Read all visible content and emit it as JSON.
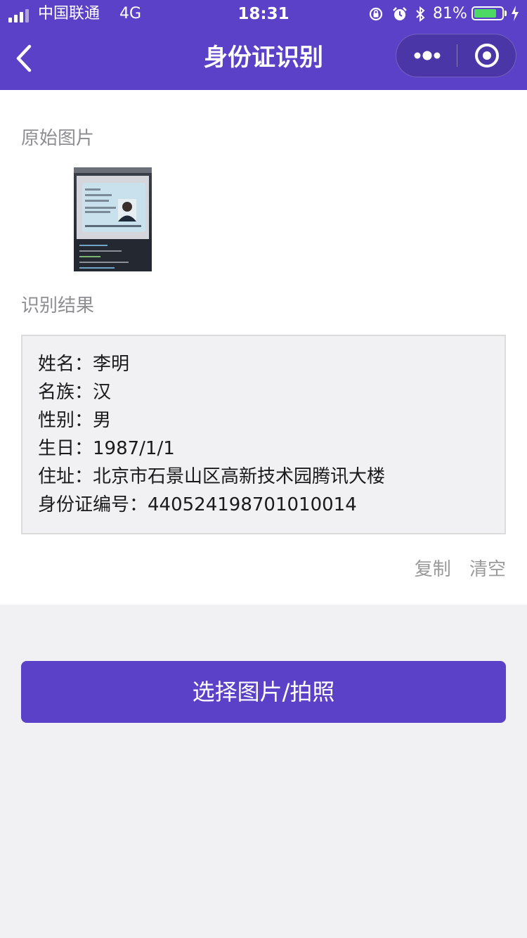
{
  "status_bar": {
    "carrier": "中国联通",
    "network": "4G",
    "time": "18:31",
    "battery_percent": "81%",
    "battery_level": 0.81,
    "signal_bars": 4,
    "icons": [
      "orientation-lock-icon",
      "alarm-icon",
      "bluetooth-icon",
      "battery-icon",
      "charging-icon"
    ]
  },
  "nav": {
    "title": "身份证识别",
    "back_icon": "chevron-left-icon",
    "more_icon": "more-dots-icon",
    "close_icon": "target-circle-icon"
  },
  "original": {
    "label": "原始图片"
  },
  "result": {
    "label": "识别结果",
    "lines": [
      "姓名：李明",
      "名族：汉",
      "性别：男",
      "生日：1987/1/1",
      "住址：北京市石景山区高新技术园腾讯大楼",
      "身份证编号：440524198701010014"
    ],
    "copy_label": "复制",
    "clear_label": "清空"
  },
  "primary_button": {
    "label": "选择图片/拍照"
  },
  "colors": {
    "accent": "#5a41c8",
    "page_bg": "#f1f0f3",
    "label_gray": "#8e8e93",
    "battery_green": "#4cd964"
  }
}
